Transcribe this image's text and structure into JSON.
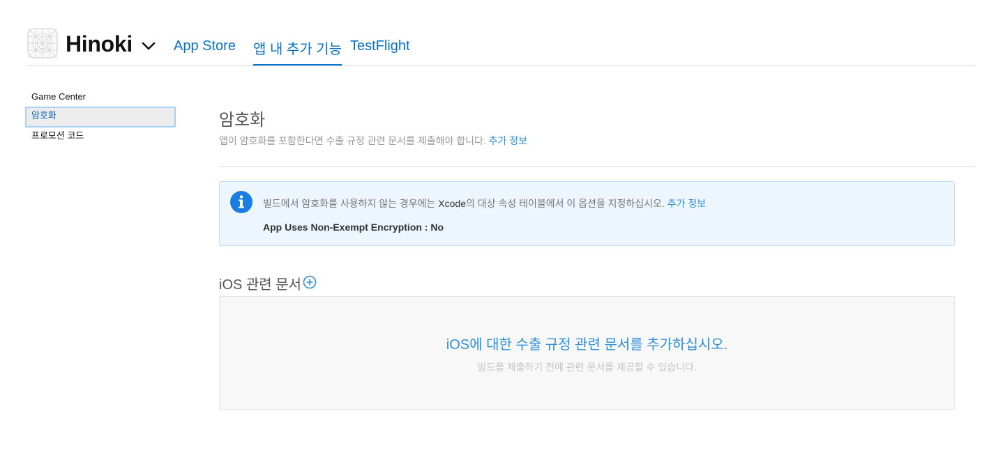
{
  "header": {
    "app_name": "Hinoki",
    "tabs": [
      {
        "label": "App Store",
        "active": false
      },
      {
        "label": "앱 내 추가 기능",
        "active": true
      },
      {
        "label": "TestFlight",
        "active": false
      }
    ]
  },
  "sidebar": {
    "items": [
      {
        "label": "Game Center",
        "active": false
      },
      {
        "label": "암호화",
        "active": true
      },
      {
        "label": "프로모션 코드",
        "active": false
      }
    ]
  },
  "main": {
    "title": "암호화",
    "description": "앱이 암호화를 포함한다면 수출 규정 관련 문서를 제출해야 합니다.",
    "description_link": "추가 정보",
    "info": {
      "text_before": "빌드에서 암호화를 사용하지 않는 경우에는 ",
      "text_xcode": "Xcode",
      "text_after": "의 대상 속성 테이블에서 이 옵션을 지정하십시오.",
      "link": "추가 정보",
      "value": "App Uses Non-Exempt Encryption : No"
    },
    "docs": {
      "title": "iOS 관련 문서",
      "empty_title": "iOS에 대한 수출 규정 관련 문서를 추가하십시오.",
      "empty_subtitle": "빌드를 제출하기 전에 관련 문서를 제공할 수 있습니다."
    }
  },
  "colors": {
    "accent": "#0a72c4",
    "link": "#2e8fd6",
    "info_bg": "#eef6fd",
    "info_icon": "#1a7ee0"
  },
  "icons": {
    "app": "app-placeholder-icon",
    "chevron": "chevron-down-icon",
    "info": "info-icon",
    "add": "plus-circle-icon"
  }
}
